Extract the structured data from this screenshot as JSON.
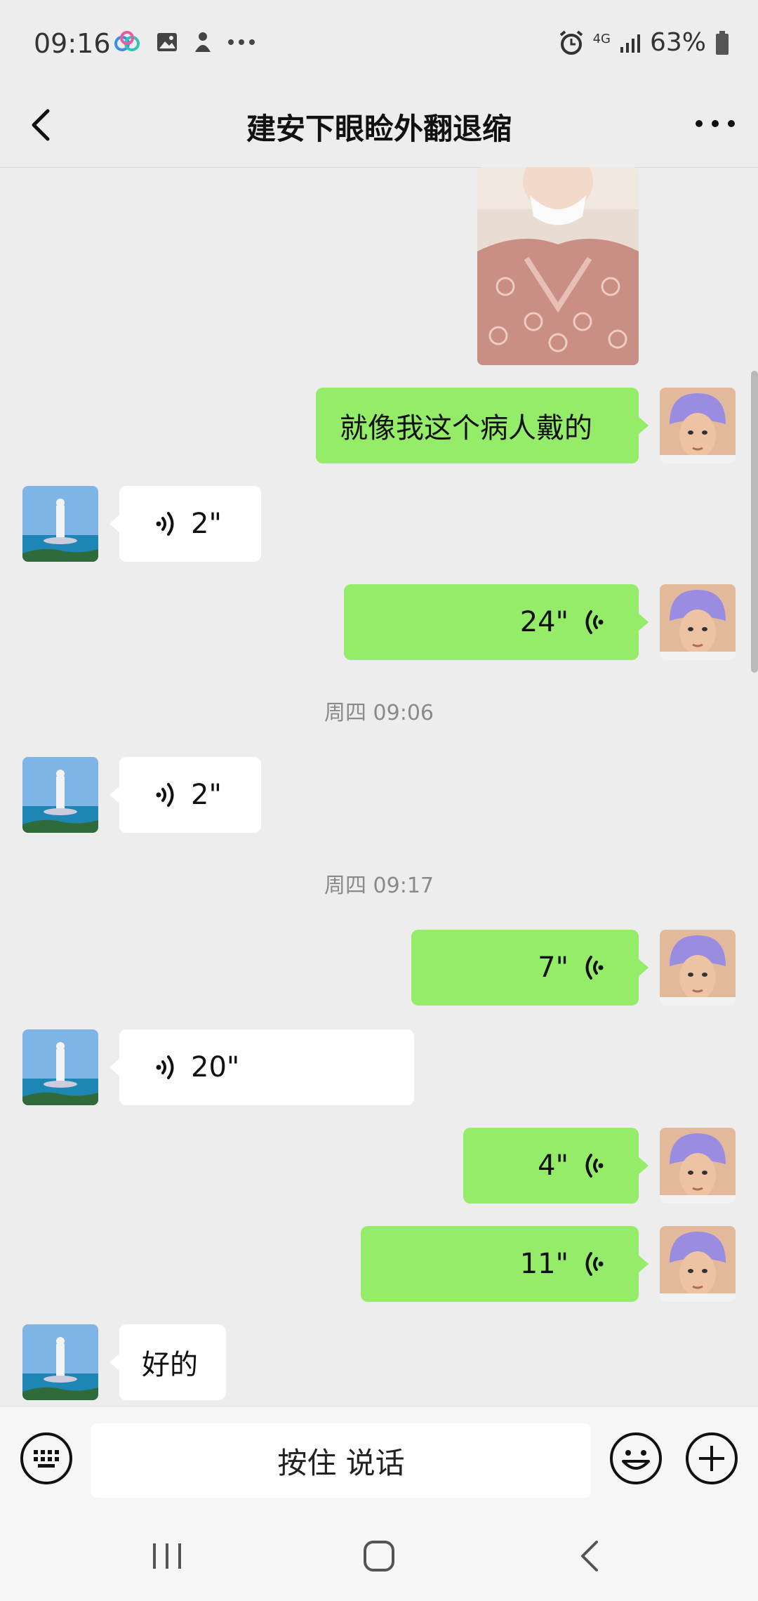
{
  "status_bar": {
    "time": "09:16",
    "left_icons": [
      "cloud-app-icon",
      "gallery-icon",
      "app-notification-icon",
      "more-dots-icon"
    ],
    "network": "4G",
    "battery": "63%"
  },
  "nav": {
    "title": "建安下眼睑外翻退缩"
  },
  "messages": [
    {
      "id": "m1",
      "type": "image",
      "sender": "self"
    },
    {
      "id": "m2",
      "type": "text",
      "sender": "self",
      "text": "就像我这个病人戴的"
    },
    {
      "id": "m3",
      "type": "voice",
      "sender": "other",
      "duration": "2\""
    },
    {
      "id": "m4",
      "type": "voice",
      "sender": "self",
      "duration": "24\""
    },
    {
      "id": "t1",
      "type": "timestamp",
      "text": "周四 09:06"
    },
    {
      "id": "m5",
      "type": "voice",
      "sender": "other",
      "duration": "2\""
    },
    {
      "id": "t2",
      "type": "timestamp",
      "text": "周四 09:17"
    },
    {
      "id": "m6",
      "type": "voice",
      "sender": "self",
      "duration": "7\""
    },
    {
      "id": "m7",
      "type": "voice",
      "sender": "other",
      "duration": "20\""
    },
    {
      "id": "m8",
      "type": "voice",
      "sender": "self",
      "duration": "4\""
    },
    {
      "id": "m9",
      "type": "voice",
      "sender": "self",
      "duration": "11\""
    },
    {
      "id": "m10",
      "type": "text",
      "sender": "other",
      "text": "好的"
    }
  ],
  "input_bar": {
    "hold_to_talk": "按住 说话",
    "keyboard_icon": "keyboard-icon",
    "emoji_icon": "emoji-icon",
    "add_icon": "plus-icon"
  },
  "colors": {
    "self_bubble": "#95ec69",
    "other_bubble": "#ffffff",
    "background": "#ededed"
  }
}
